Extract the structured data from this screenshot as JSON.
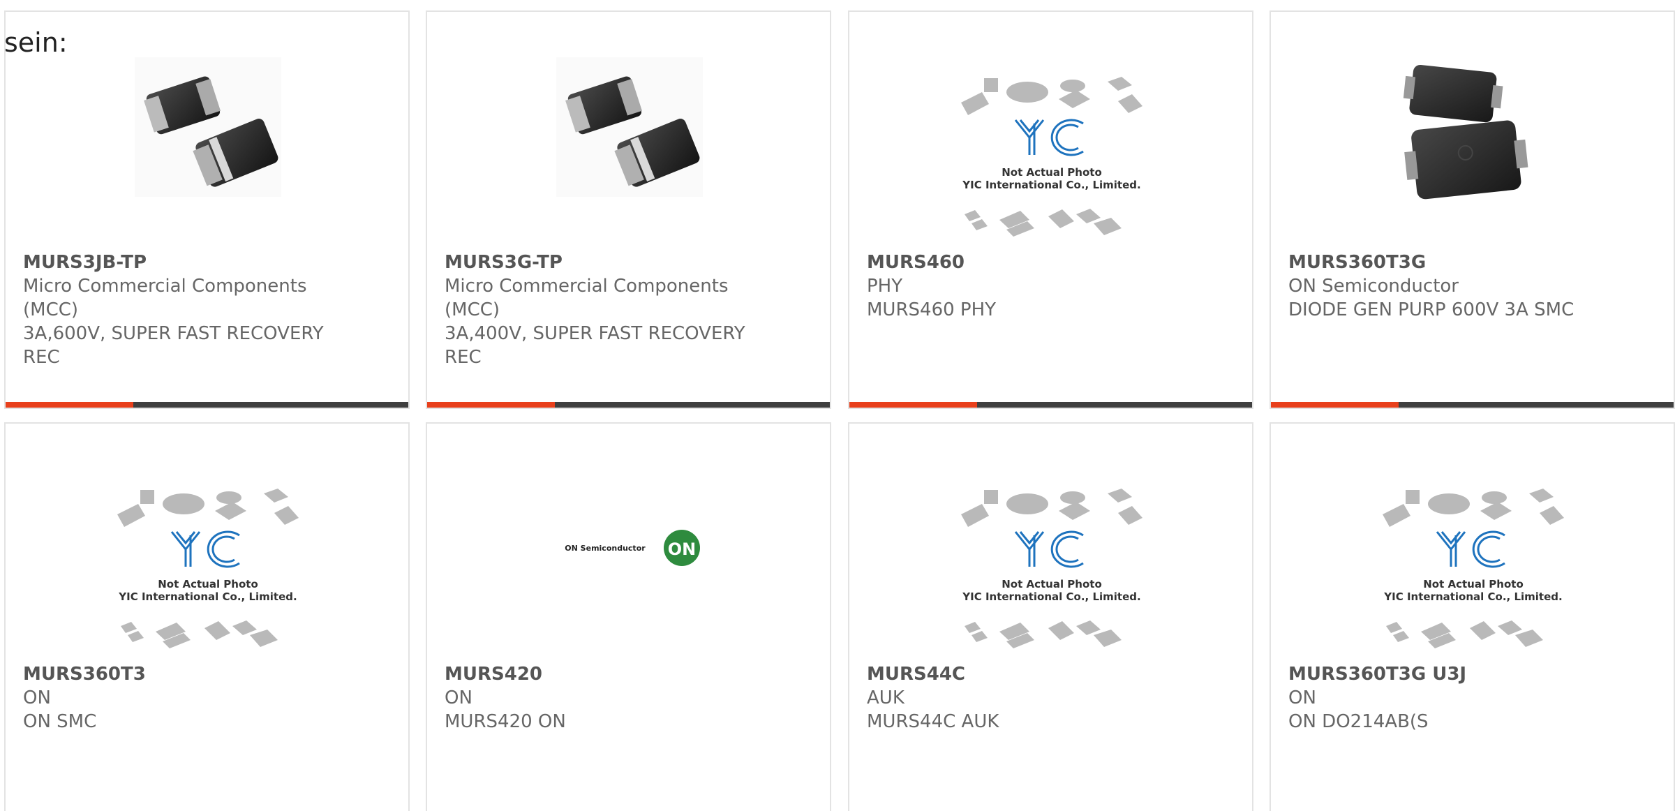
{
  "lead_text": "sein:",
  "colors": {
    "accent": "#e8401c",
    "bar": "#3f3f3f",
    "card_border": "#e3e3e3",
    "text": "#666666",
    "logo_blue": "#1e73be",
    "on_green": "#2e8b3e"
  },
  "placeholder": {
    "line1": "Not Actual Photo",
    "line2": "YIC International Co., Limited.",
    "logo": "YIC"
  },
  "on_logo": {
    "wordmark": "ON Semiconductor",
    "mark": "ON"
  },
  "products": [
    {
      "part_number": "MURS3JB-TP",
      "manufacturer": "Micro Commercial Components (MCC)",
      "description": "3A,600V, SUPER FAST RECOVERY REC",
      "image": "smd-diode-photo",
      "accent_bar": true
    },
    {
      "part_number": "MURS3G-TP",
      "manufacturer": "Micro Commercial Components (MCC)",
      "description": "3A,400V, SUPER FAST RECOVERY REC",
      "image": "smd-diode-photo",
      "accent_bar": true
    },
    {
      "part_number": "MURS460",
      "manufacturer": "PHY",
      "description": "MURS460 PHY",
      "image": "not-actual-photo-placeholder",
      "accent_bar": true
    },
    {
      "part_number": "MURS360T3G",
      "manufacturer": "ON Semiconductor",
      "description": "DIODE GEN PURP 600V 3A SMC",
      "image": "smc-package-photo",
      "accent_bar": true
    },
    {
      "part_number": "MURS360T3",
      "manufacturer": "ON",
      "description": "ON SMC",
      "image": "not-actual-photo-placeholder",
      "accent_bar": false
    },
    {
      "part_number": "MURS420",
      "manufacturer": "ON",
      "description": "MURS420 ON",
      "image": "on-semiconductor-logo",
      "accent_bar": false
    },
    {
      "part_number": "MURS44C",
      "manufacturer": "AUK",
      "description": "MURS44C AUK",
      "image": "not-actual-photo-placeholder",
      "accent_bar": false
    },
    {
      "part_number": "MURS360T3G U3J",
      "manufacturer": "ON",
      "description": "ON DO214AB(S",
      "image": "not-actual-photo-placeholder",
      "accent_bar": false
    }
  ]
}
